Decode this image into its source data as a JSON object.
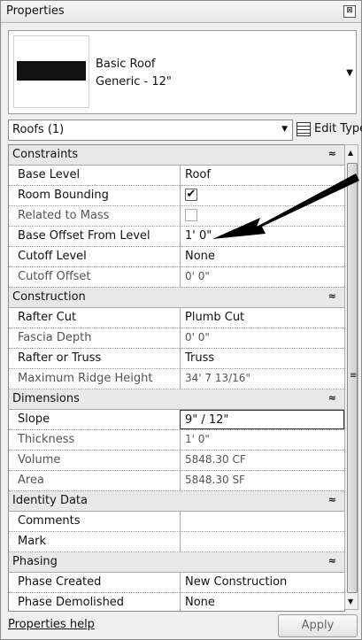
{
  "window": {
    "title": "Properties",
    "close_label": "⊠"
  },
  "type_selector": {
    "family": "Basic Roof",
    "type": "Generic - 12\""
  },
  "filter": {
    "value": "Roofs (1)",
    "edit_type_label": "Edit Type"
  },
  "groups": {
    "constraints": "Constraints",
    "construction": "Construction",
    "dimensions": "Dimensions",
    "identity": "Identity Data",
    "phasing": "Phasing"
  },
  "params": {
    "base_level": {
      "label": "Base Level",
      "value": "Roof"
    },
    "room_bounding": {
      "label": "Room Bounding",
      "checked": true
    },
    "related_to_mass": {
      "label": "Related to Mass",
      "checked": false
    },
    "base_offset": {
      "label": "Base Offset From Level",
      "value": "1'  0\""
    },
    "cutoff_level": {
      "label": "Cutoff Level",
      "value": "None"
    },
    "cutoff_offset": {
      "label": "Cutoff Offset",
      "value": "0'  0\""
    },
    "rafter_cut": {
      "label": "Rafter Cut",
      "value": "Plumb Cut"
    },
    "fascia_depth": {
      "label": "Fascia Depth",
      "value": "0'  0\""
    },
    "rafter_or_truss": {
      "label": "Rafter or Truss",
      "value": "Truss"
    },
    "max_ridge": {
      "label": "Maximum Ridge Height",
      "value": "34'  7 13/16\""
    },
    "slope": {
      "label": "Slope",
      "value": "9\" / 12\""
    },
    "thickness": {
      "label": "Thickness",
      "value": "1'  0\""
    },
    "volume": {
      "label": "Volume",
      "value": "5848.30 CF"
    },
    "area": {
      "label": "Area",
      "value": "5848.30 SF"
    },
    "comments": {
      "label": "Comments",
      "value": ""
    },
    "mark": {
      "label": "Mark",
      "value": ""
    },
    "phase_created": {
      "label": "Phase Created",
      "value": "New Construction"
    },
    "phase_demolished": {
      "label": "Phase Demolished",
      "value": "None"
    }
  },
  "footer": {
    "help_label": "Properties help",
    "apply_label": "Apply"
  },
  "icons": {
    "collapse": "chevron-double-up-icon",
    "check": "checkmark-icon"
  }
}
